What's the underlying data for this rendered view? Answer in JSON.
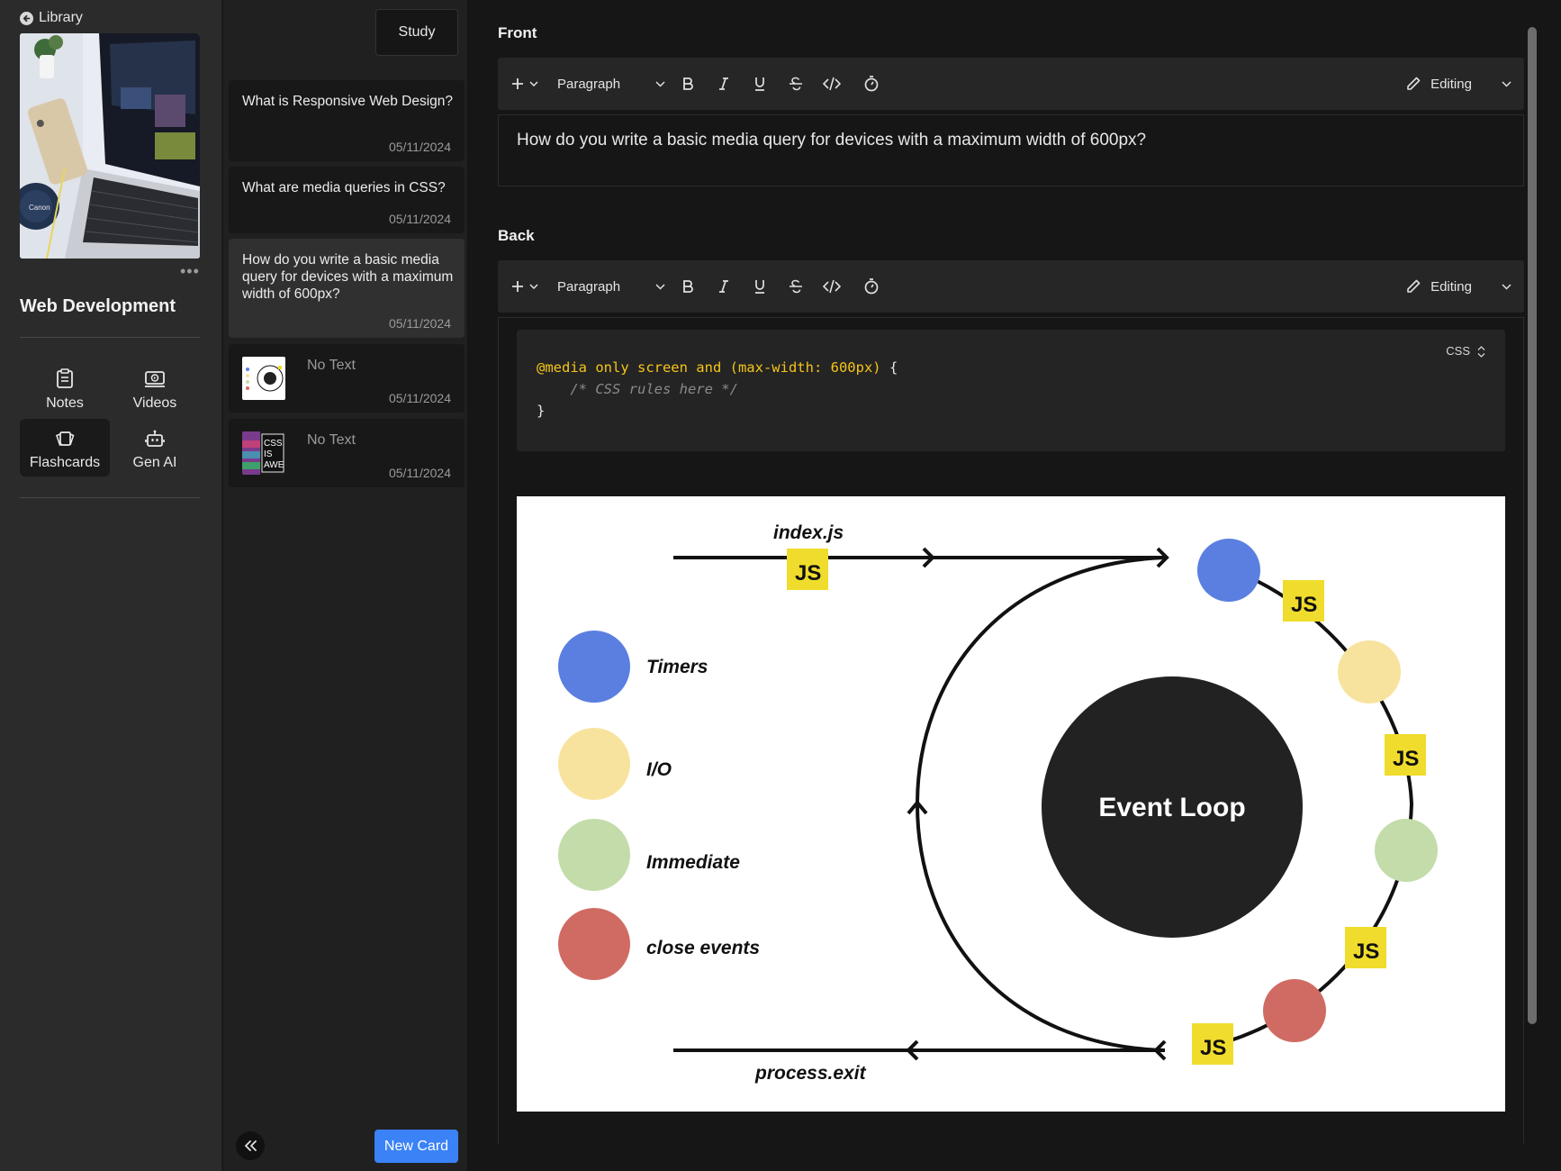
{
  "sidebar": {
    "back_label": "Library",
    "deck_title": "Web Development",
    "more_label": "•••",
    "nav": [
      {
        "label": "Notes",
        "icon": "notes-icon"
      },
      {
        "label": "Videos",
        "icon": "video-icon"
      },
      {
        "label": "Flashcards",
        "icon": "flashcards-icon",
        "active": true
      },
      {
        "label": "Gen AI",
        "icon": "robot-icon"
      }
    ]
  },
  "cardlist": {
    "study_label": "Study",
    "new_card_label": "New Card",
    "cards": [
      {
        "question": "What is Responsive Web Design?",
        "date": "05/11/2024"
      },
      {
        "question": "What are media queries in CSS?",
        "date": "05/11/2024"
      },
      {
        "question": "How do you write a basic media query for devices with a maximum width of 600px?",
        "date": "05/11/2024",
        "active": true
      },
      {
        "question": "No Text",
        "date": "05/11/2024",
        "thumb": "event-loop-thumbnail"
      },
      {
        "question": "No Text",
        "date": "05/11/2024",
        "thumb": "css-is-awesome-thumbnail",
        "thumb_text": [
          "CSS",
          "IS",
          "AWE"
        ]
      }
    ]
  },
  "editor": {
    "front_label": "Front",
    "back_label": "Back",
    "toolbar": {
      "block_type": "Paragraph",
      "mode_label": "Editing"
    },
    "front_text": "How do you write a basic media query for devices with a maximum width of 600px?",
    "code": {
      "language": "CSS",
      "line1_kw": "@media only screen and (max-width: 600px)",
      "line1_rest": " {",
      "line2": "    /* CSS rules here */",
      "line3": "}"
    },
    "diagram": {
      "top_label": "index.js",
      "bottom_label": "process.exit",
      "center_label": "Event Loop",
      "js_badge": "JS",
      "legend": [
        {
          "label": "Timers",
          "color": "#5b7fe0"
        },
        {
          "label": "I/O",
          "color": "#f8e39e"
        },
        {
          "label": "Immediate",
          "color": "#c3dcaa"
        },
        {
          "label": "close events",
          "color": "#d06b63"
        }
      ]
    }
  },
  "colors": {
    "accent": "#3b82f6",
    "code_keyword": "#f5c518",
    "js_yellow": "#f0dc2c"
  }
}
